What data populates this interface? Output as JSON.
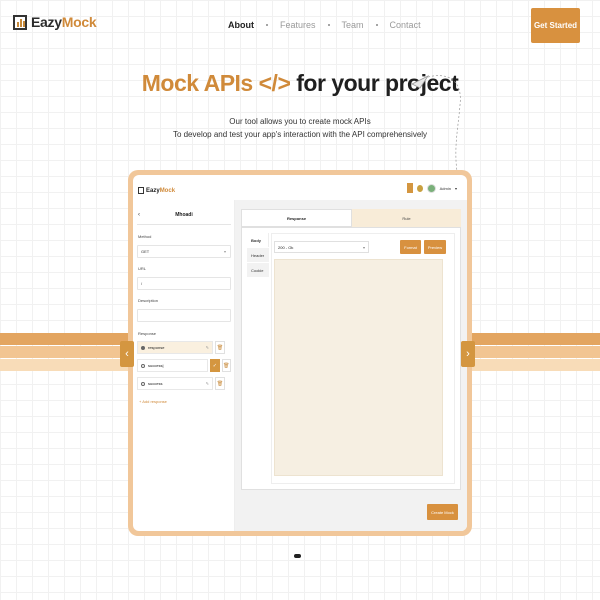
{
  "brand": {
    "name_a": "Eazy",
    "name_b": "Mock"
  },
  "nav": {
    "items": [
      {
        "label": "About",
        "active": true
      },
      {
        "label": "Features",
        "active": false
      },
      {
        "label": "Team",
        "active": false
      },
      {
        "label": "Contact",
        "active": false
      }
    ],
    "cta_label": "Get Started"
  },
  "hero": {
    "title_a": "Mock APIs </>",
    "title_b": " for your project",
    "subtitle_line1": "Our tool allows you to create mock APIs",
    "subtitle_line2": "To develop and test your app's interaction with the API comprehensively"
  },
  "app": {
    "brand_a": "Eazy",
    "brand_b": "Mock",
    "user_label": "Admin",
    "back_icon": "chevron-left-icon",
    "endpoint_name": "Mhoadi",
    "method_label": "Method",
    "method_value": "GET",
    "url_label": "URL",
    "url_value": "/",
    "description_label": "Description",
    "response_label": "Response",
    "responses": [
      {
        "name": "response",
        "selected": true
      },
      {
        "name": "success|",
        "selected": false
      },
      {
        "name": "success",
        "selected": false
      }
    ],
    "add_response_label": "+ Add response",
    "tabs": [
      {
        "label": "Response",
        "active": true
      },
      {
        "label": "Rule",
        "active": false
      }
    ],
    "side_tabs": [
      {
        "label": "Body",
        "active": true
      },
      {
        "label": "Header",
        "active": false
      },
      {
        "label": "Cookie",
        "active": false
      }
    ],
    "status_value": "200 - Ok",
    "format_label": "Format",
    "preview_label": "Preview",
    "create_label": "Create Mock"
  },
  "colors": {
    "accent": "#d8913f",
    "brand_orange": "#d08a3a",
    "band_1": "#e3a560",
    "band_2": "#f2c592",
    "band_3": "#f8dcb8"
  }
}
